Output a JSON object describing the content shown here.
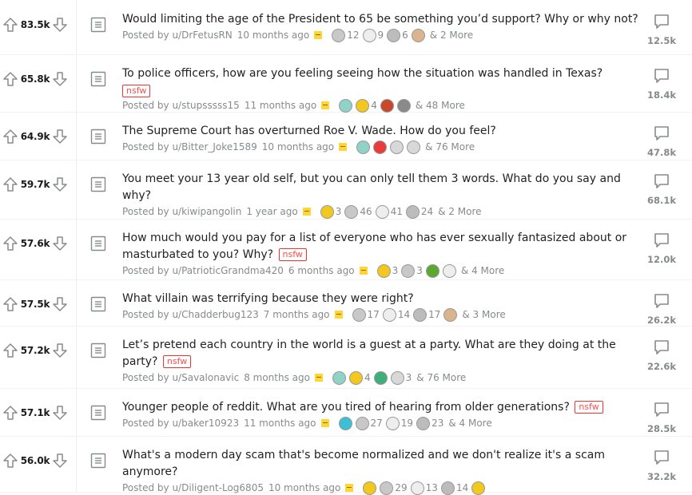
{
  "posts": [
    {
      "score": "83.5k",
      "title": "Would limiting the age of the President to 65 be something you’d support? Why or why not?",
      "nsfw": false,
      "nsfw_label": "",
      "author": "Posted by u/DrFetusRN",
      "time": "10 months ago",
      "awards": [
        {
          "icon": "silver-award-icon",
          "color": "#c8c8c8",
          "count": "12"
        },
        {
          "icon": "helpful-award-icon",
          "color": "#eeeeee",
          "count": "9"
        },
        {
          "icon": "wholesome-award-icon",
          "color": "#bcbcbc",
          "count": "6"
        },
        {
          "icon": "doge-award-icon",
          "color": "#d9b48f",
          "count": ""
        }
      ],
      "more": "& 2 More",
      "comments": "12.5k"
    },
    {
      "score": "65.8k",
      "title": "To police officers, how are you feeling seeing how the situation was handled in Texas?",
      "nsfw": true,
      "nsfw_label": "nsfw",
      "author": "Posted by u/stupsssss15",
      "time": "11 months ago",
      "awards": [
        {
          "icon": "platinum-award-icon",
          "color": "#8fd3c8",
          "count": ""
        },
        {
          "icon": "gold-award-icon",
          "color": "#f2c81c",
          "count": "4"
        },
        {
          "icon": "gift-award-icon",
          "color": "#c9472b",
          "count": ""
        },
        {
          "icon": "snoo-award-icon",
          "color": "#8a8a8a",
          "count": ""
        }
      ],
      "more": "& 48 More",
      "comments": "18.4k"
    },
    {
      "score": "64.9k",
      "title": "The Supreme Court has overturned Roe V. Wade. How do you feel?",
      "nsfw": false,
      "nsfw_label": "",
      "author": "Posted by u/Bitter_Joke1589",
      "time": "10 months ago",
      "awards": [
        {
          "icon": "platinum-award-icon",
          "color": "#8fd3c8",
          "count": ""
        },
        {
          "icon": "heart-eyes-award-icon",
          "color": "#e83c3c",
          "count": ""
        },
        {
          "icon": "snoo-hat-award-icon",
          "color": "#d8d8d8",
          "count": ""
        },
        {
          "icon": "facepalm-award-icon",
          "color": "#d8d8d8",
          "count": ""
        }
      ],
      "more": "& 76 More",
      "comments": "47.8k"
    },
    {
      "score": "59.7k",
      "title": "You meet your 13 year old self, but you can only tell them 3 words. What do you say and why?",
      "nsfw": false,
      "nsfw_label": "",
      "author": "Posted by u/kiwipangolin",
      "time": "1 year ago",
      "awards": [
        {
          "icon": "gold-award-icon",
          "color": "#f2c81c",
          "count": "3"
        },
        {
          "icon": "silver-award-icon",
          "color": "#c8c8c8",
          "count": "46"
        },
        {
          "icon": "helpful-award-icon",
          "color": "#eeeeee",
          "count": "41"
        },
        {
          "icon": "wholesome-award-icon",
          "color": "#bcbcbc",
          "count": "24"
        }
      ],
      "more": "& 2 More",
      "comments": "68.1k"
    },
    {
      "score": "57.6k",
      "title": "How much would you pay for a list of everyone who has ever sexually fantasized about or masturbated to you? Why?",
      "nsfw": true,
      "nsfw_label": "nsfw",
      "author": "Posted by u/PatrioticGrandma420",
      "time": "6 months ago",
      "awards": [
        {
          "icon": "gold-award-icon",
          "color": "#f2c81c",
          "count": "3"
        },
        {
          "icon": "silver-award-icon",
          "color": "#c8c8c8",
          "count": "3"
        },
        {
          "icon": "table-slap-award-icon",
          "color": "#5aa832",
          "count": ""
        },
        {
          "icon": "helpful-award-icon",
          "color": "#eeeeee",
          "count": ""
        }
      ],
      "more": "& 4 More",
      "comments": "12.0k"
    },
    {
      "score": "57.5k",
      "title": "What villain was terrifying because they were right?",
      "nsfw": false,
      "nsfw_label": "",
      "author": "Posted by u/Chadderbug123",
      "time": "7 months ago",
      "awards": [
        {
          "icon": "silver-award-icon",
          "color": "#c8c8c8",
          "count": "17"
        },
        {
          "icon": "helpful-award-icon",
          "color": "#eeeeee",
          "count": "14"
        },
        {
          "icon": "wholesome-award-icon",
          "color": "#bcbcbc",
          "count": "17"
        },
        {
          "icon": "doge-award-icon",
          "color": "#d9b48f",
          "count": ""
        }
      ],
      "more": "& 3 More",
      "comments": "26.2k"
    },
    {
      "score": "57.2k",
      "title": "Let’s pretend each country in the world is a guest at a party. What are they doing at the party?",
      "nsfw": true,
      "nsfw_label": "nsfw",
      "author": "Posted by u/Savalonavic",
      "time": "8 months ago",
      "awards": [
        {
          "icon": "platinum-award-icon",
          "color": "#8fd3c8",
          "count": ""
        },
        {
          "icon": "gold-award-icon",
          "color": "#f2c81c",
          "count": "4"
        },
        {
          "icon": "frog-award-icon",
          "color": "#3fae7a",
          "count": ""
        },
        {
          "icon": "snoo-hat-award-icon",
          "color": "#d8d8d8",
          "count": "3"
        }
      ],
      "more": "& 76 More",
      "comments": "22.6k"
    },
    {
      "score": "57.1k",
      "title": "Younger people of reddit. What are you tired of hearing from older generations?",
      "nsfw": true,
      "nsfw_label": "nsfw",
      "author": "Posted by u/baker10923",
      "time": "11 months ago",
      "awards": [
        {
          "icon": "arrow-award-icon",
          "color": "#3fbfd6",
          "count": ""
        },
        {
          "icon": "silver-award-icon",
          "color": "#c8c8c8",
          "count": "27"
        },
        {
          "icon": "helpful-award-icon",
          "color": "#eeeeee",
          "count": "19"
        },
        {
          "icon": "wholesome-award-icon",
          "color": "#bcbcbc",
          "count": "23"
        }
      ],
      "more": "& 4 More",
      "comments": "28.5k"
    },
    {
      "score": "56.0k",
      "title": "What's a modern day scam that's become normalized and we don't realize it's a scam anymore?",
      "nsfw": false,
      "nsfw_label": "",
      "author": "Posted by u/Diligent-Log6805",
      "time": "10 months ago",
      "awards": [
        {
          "icon": "gold-award-icon",
          "color": "#f2c81c",
          "count": ""
        },
        {
          "icon": "silver-award-icon",
          "color": "#c8c8c8",
          "count": "29"
        },
        {
          "icon": "helpful-award-icon",
          "color": "#eeeeee",
          "count": "13"
        },
        {
          "icon": "wholesome-award-icon",
          "color": "#bcbcbc",
          "count": "14"
        },
        {
          "icon": "hat-award-icon",
          "color": "#f2c81c",
          "count": ""
        }
      ],
      "more": "",
      "comments": "32.2k"
    }
  ]
}
